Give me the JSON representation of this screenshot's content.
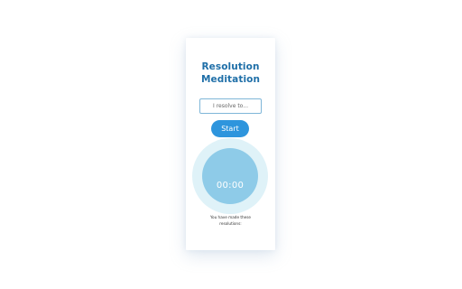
{
  "app": {
    "title_line1": "Resolution",
    "title_line2": "Meditation"
  },
  "form": {
    "input_placeholder": "I resolve to...",
    "input_value": "",
    "start_label": "Start"
  },
  "timer": {
    "display": "00:00"
  },
  "resolutions": {
    "caption": "You have made these resolutions:"
  },
  "colors": {
    "title": "#1f6fa8",
    "button": "#2e95dd",
    "timer_outer": "#dff2f8",
    "timer_inner": "#8ecbe8",
    "input_border": "#7fb6d8"
  }
}
